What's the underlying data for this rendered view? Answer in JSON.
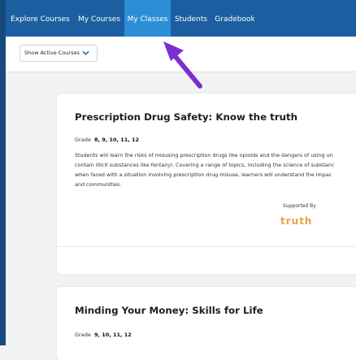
{
  "nav": {
    "items": [
      {
        "label": "Explore Courses",
        "active": false
      },
      {
        "label": "My Courses",
        "active": false
      },
      {
        "label": "My Classes",
        "active": true
      },
      {
        "label": "Students",
        "active": false
      },
      {
        "label": "Gradebook",
        "active": false
      }
    ]
  },
  "filter": {
    "selected": "Show Active Courses",
    "icon": "chevron-down-icon"
  },
  "courses": [
    {
      "title": "Prescription Drug Safety: Know the truth",
      "grade_label": "Grade",
      "grades": "8, 9, 10, 11, 12",
      "description_lines": [
        "Students will learn the risks of misusing prescription drugs like opioids and the dangers of using un",
        "contain illicit substances like fentanyl. Covering a range of topics, including the science of substanc",
        "when faced with a situation involving prescription drug misuse, learners will understand the impac",
        "and communities."
      ],
      "supported_by": "Supported By",
      "sponsor_logo": "truth"
    },
    {
      "title": "Minding Your Money: Skills for Life",
      "grade_label": "Grade",
      "grades": "9, 10, 11, 12"
    }
  ],
  "annotation": {
    "icon": "arrow-icon",
    "color": "#7a2fd0"
  },
  "colors": {
    "nav_bg": "#1b5fa0",
    "nav_active": "#2b8fd6",
    "logo": "#e9a33b"
  }
}
